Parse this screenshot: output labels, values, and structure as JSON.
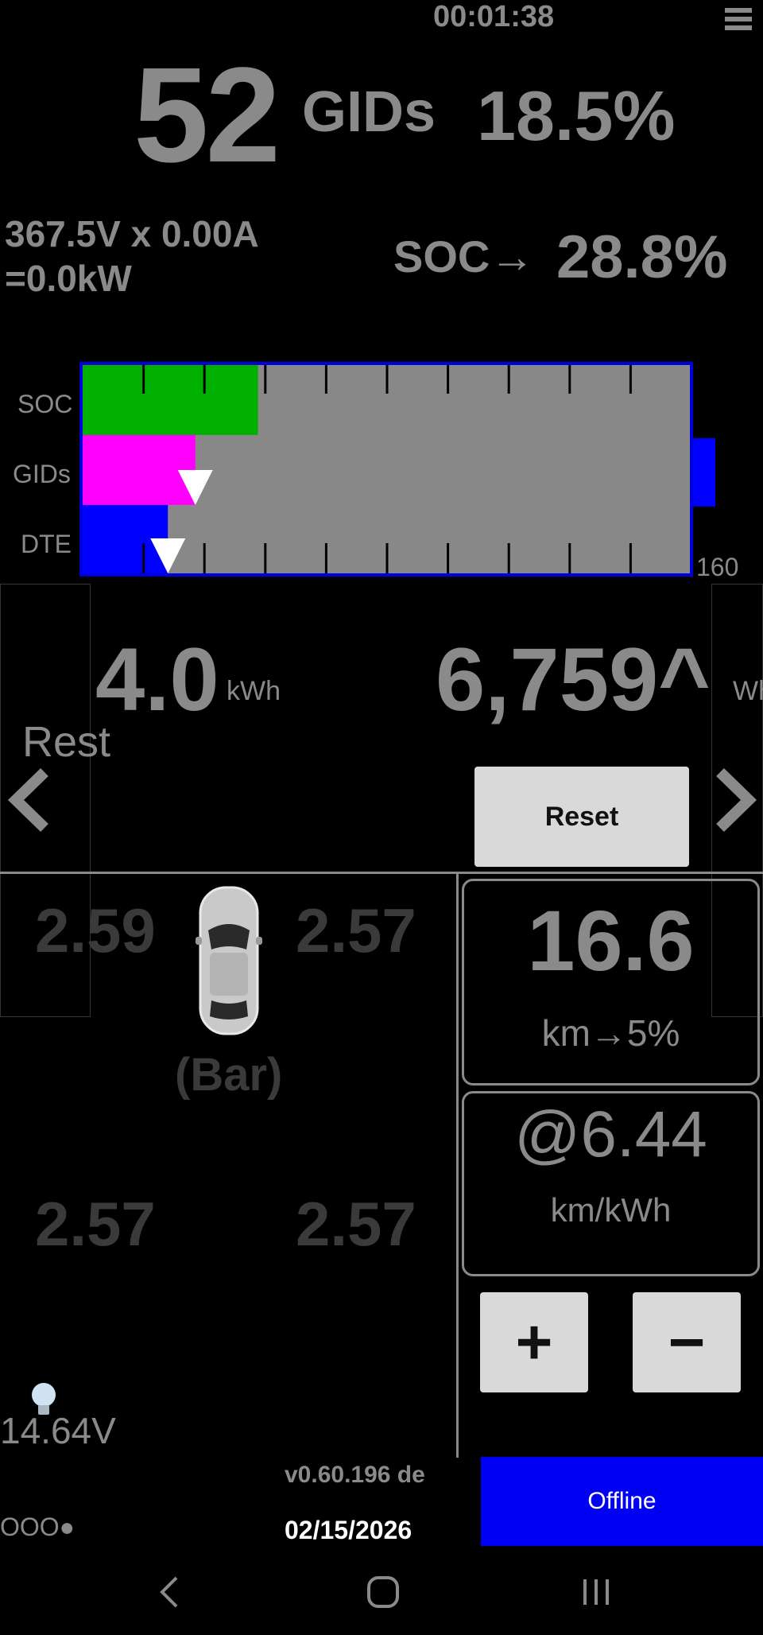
{
  "status": {
    "time": "00:01:38"
  },
  "menu": {
    "icon": "menu-icon"
  },
  "summary": {
    "gids": "52",
    "gids_unit": "GIDs",
    "gids_percent": "18.5%",
    "voltage_line1": "367.5V x 0.00A",
    "voltage_line2": "=0.0kW",
    "soc_label": "SOC→",
    "soc_value": "28.8%"
  },
  "battery_bar": {
    "labels": [
      "SOC",
      "GIDs",
      "DTE"
    ],
    "max_label": "160",
    "soc_fraction": 0.288,
    "gids_fraction": 0.185,
    "dte_fraction": 0.14,
    "colors": {
      "soc": "#00b000",
      "gids": "#ff00ff",
      "dte": "#0000ff",
      "track": "#888888",
      "border": "#0000dd"
    }
  },
  "energy": {
    "kwh_value": "4.0",
    "kwh_unit": "kWh",
    "wh_value": "6,759^",
    "wh_unit": "Wh",
    "mode_label": "Rest",
    "reset_label": "Reset"
  },
  "tires": {
    "front_left": "2.59",
    "front_right": "2.57",
    "rear_left": "2.57",
    "rear_right": "2.57",
    "unit_label": "(Bar)"
  },
  "range": {
    "distance": "16.6",
    "distance_label": "km→5%",
    "efficiency": "@6.44",
    "efficiency_label": "km/kWh",
    "plus_label": "+",
    "minus_label": "−"
  },
  "footer": {
    "aux_voltage": "14.64V",
    "version": "v0.60.196 de",
    "connection_status": "Offline",
    "indicator": "OOO●",
    "date": "02/15/2026"
  }
}
